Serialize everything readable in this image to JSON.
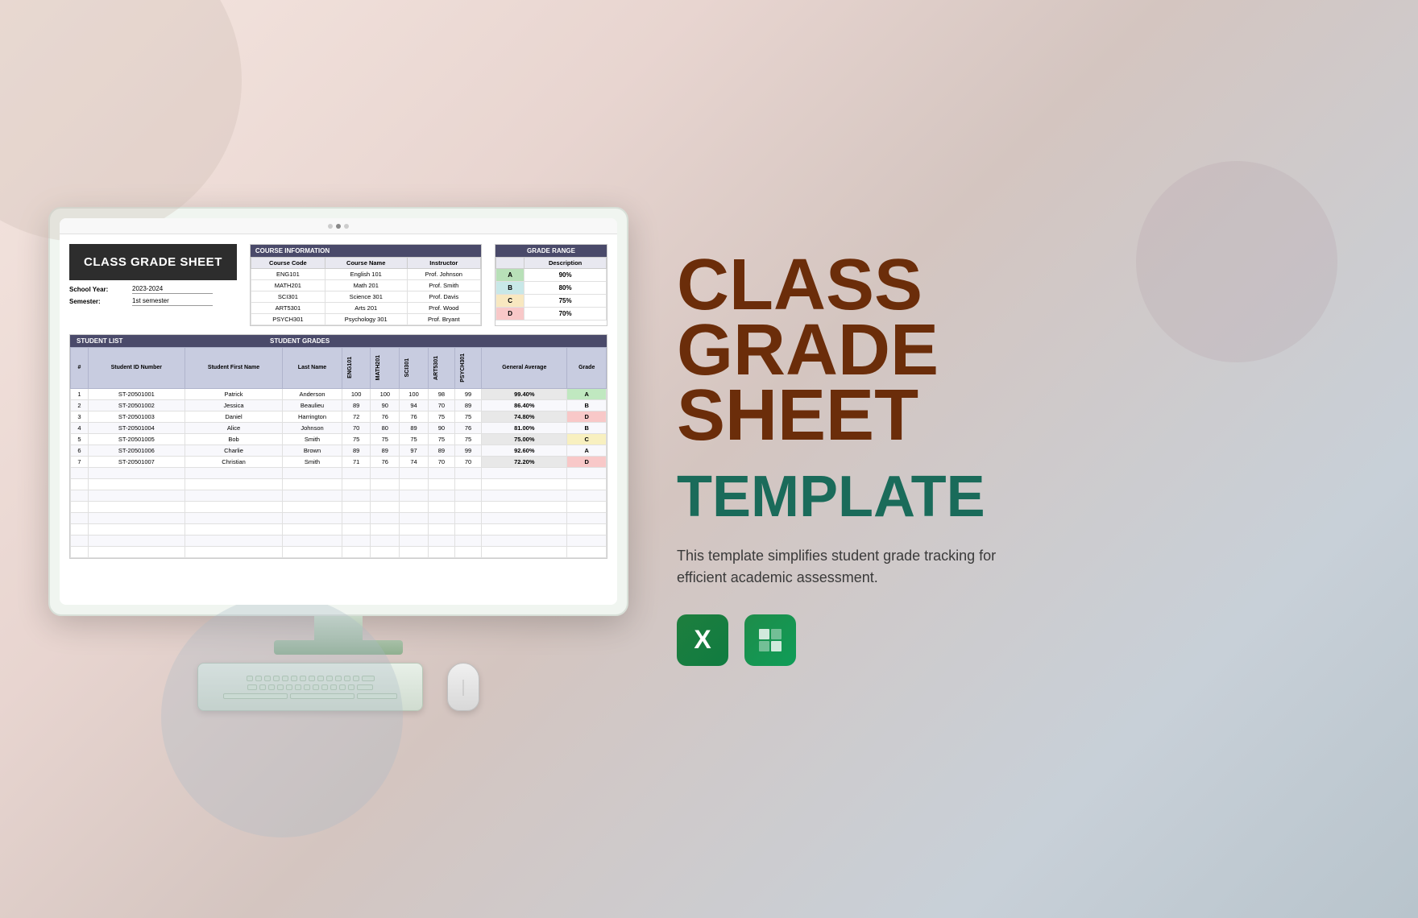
{
  "background": {
    "description": "Abstract watercolor background with soft peach, blue, and gray tones"
  },
  "monitor": {
    "title": "CLASS GRADE SHEET",
    "school_year_label": "School Year:",
    "school_year_value": "2023-2024",
    "semester_label": "Semester:",
    "semester_value": "1st semester",
    "course_info": {
      "section_label": "COURSE INFORMATION",
      "columns": [
        "Course Code",
        "Course Name",
        "Instructor"
      ],
      "rows": [
        [
          "ENG101",
          "English 101",
          "Prof. Johnson"
        ],
        [
          "MATH201",
          "Math 201",
          "Prof. Smith"
        ],
        [
          "SCI301",
          "Science 301",
          "Prof. Davis"
        ],
        [
          "ART5301",
          "Arts 201",
          "Prof. Wood"
        ],
        [
          "PSYCH301",
          "Psychology 301",
          "Prof. Bryant"
        ]
      ]
    },
    "grade_range": {
      "section_label": "GRADE RANGE",
      "columns": [
        "Description"
      ],
      "rows": [
        {
          "grade": "A",
          "color": "grade-a",
          "value": "90%"
        },
        {
          "grade": "B",
          "color": "grade-b",
          "value": "80%"
        },
        {
          "grade": "C",
          "color": "grade-c",
          "value": "75%"
        },
        {
          "grade": "D",
          "color": "grade-d",
          "value": "70%"
        }
      ]
    },
    "student_section": {
      "list_header": "STUDENT LIST",
      "grades_header": "STUDENT GRADES",
      "columns": [
        "#",
        "Student ID Number",
        "Student First Name",
        "Last Name",
        "ENG101",
        "MATH201",
        "SCI301",
        "ART5301",
        "PSYCH301",
        "General Average",
        "Grade"
      ],
      "subject_codes": [
        "ENG101",
        "MATH201",
        "SCI301",
        "ART5301",
        "PSYCH301"
      ],
      "rows": [
        {
          "num": 1,
          "id": "ST-20501001",
          "first": "Patrick",
          "last": "Anderson",
          "scores": [
            100,
            100,
            100,
            98,
            99
          ],
          "avg": "99.40%",
          "grade": "A",
          "grade_class": "grade-cell-a"
        },
        {
          "num": 2,
          "id": "ST-20501002",
          "first": "Jessica",
          "last": "Beaulieu",
          "scores": [
            89,
            90,
            94,
            70,
            89
          ],
          "avg": "86.40%",
          "grade": "B",
          "grade_class": "grade-cell-b"
        },
        {
          "num": 3,
          "id": "ST-20501003",
          "first": "Daniel",
          "last": "Harrington",
          "scores": [
            72,
            76,
            76,
            75,
            75
          ],
          "avg": "74.80%",
          "grade": "D",
          "grade_class": "grade-cell-d"
        },
        {
          "num": 4,
          "id": "ST-20501004",
          "first": "Alice",
          "last": "Johnson",
          "scores": [
            70,
            80,
            89,
            90,
            76
          ],
          "avg": "81.00%",
          "grade": "B",
          "grade_class": "grade-cell-b"
        },
        {
          "num": 5,
          "id": "ST-20501005",
          "first": "Bob",
          "last": "Smith",
          "scores": [
            75,
            75,
            75,
            75,
            75
          ],
          "avg": "75.00%",
          "grade": "C",
          "grade_class": "grade-cell-c"
        },
        {
          "num": 6,
          "id": "ST-20501006",
          "first": "Charlie",
          "last": "Brown",
          "scores": [
            89,
            89,
            97,
            89,
            99
          ],
          "avg": "92.60%",
          "grade": "A",
          "grade_class": "grade-cell-a"
        },
        {
          "num": 7,
          "id": "ST-20501007",
          "first": "Christian",
          "last": "Smith",
          "scores": [
            71,
            76,
            74,
            70,
            70
          ],
          "avg": "72.20%",
          "grade": "D",
          "grade_class": "grade-cell-d"
        }
      ]
    }
  },
  "right_panel": {
    "title_line1": "CLASS",
    "title_line2": "GRADE",
    "title_line3": "SHEET",
    "subtitle": "TEMPLATE",
    "description": "This template simplifies student grade tracking for efficient academic assessment.",
    "icons": [
      {
        "name": "excel",
        "label": "X",
        "type": "excel"
      },
      {
        "name": "google-sheets",
        "label": "grid",
        "type": "sheets"
      }
    ]
  }
}
